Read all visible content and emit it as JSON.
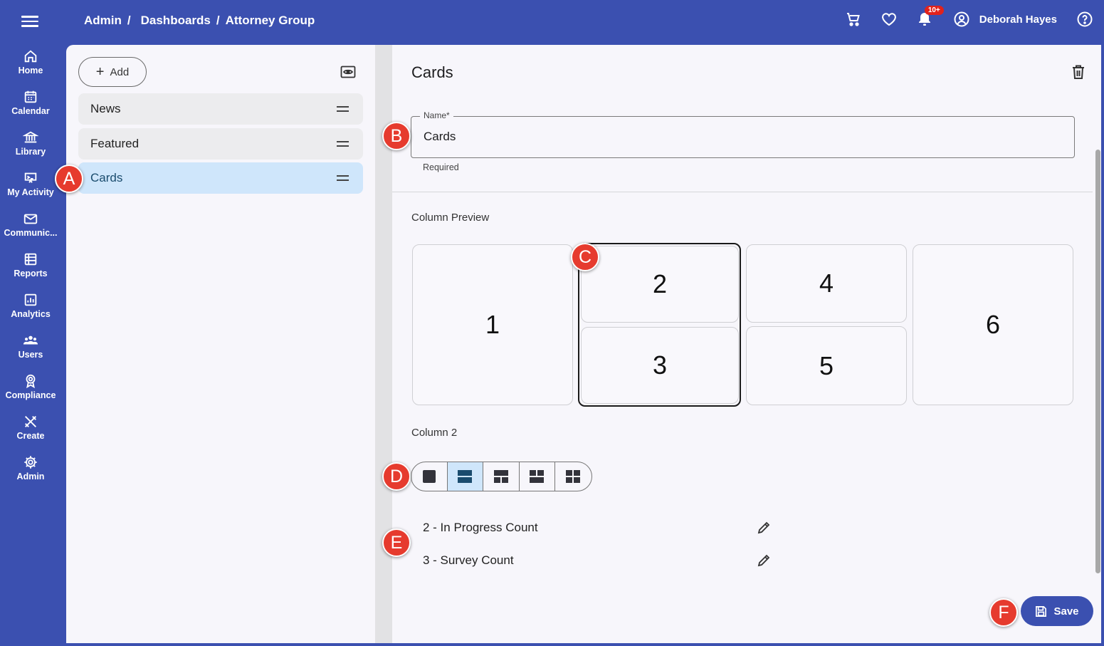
{
  "topbar": {
    "breadcrumb": [
      "Admin",
      "Dashboards",
      "Attorney Group"
    ],
    "separator": "/",
    "notification_count": "10+",
    "user_name": "Deborah Hayes"
  },
  "sidebar": {
    "items": [
      {
        "label": "Home",
        "icon": "home-icon"
      },
      {
        "label": "Calendar",
        "icon": "calendar-icon"
      },
      {
        "label": "Library",
        "icon": "library-icon"
      },
      {
        "label": "My Activity",
        "icon": "activity-icon"
      },
      {
        "label": "Communic...",
        "icon": "mail-icon"
      },
      {
        "label": "Reports",
        "icon": "reports-icon"
      },
      {
        "label": "Analytics",
        "icon": "analytics-icon"
      },
      {
        "label": "Users",
        "icon": "users-icon"
      },
      {
        "label": "Compliance",
        "icon": "compliance-icon"
      },
      {
        "label": "Create",
        "icon": "create-icon"
      },
      {
        "label": "Admin",
        "icon": "admin-gear-icon"
      }
    ]
  },
  "left_panel": {
    "add_label": "Add",
    "items": [
      {
        "label": "News",
        "active": false
      },
      {
        "label": "Featured",
        "active": false
      },
      {
        "label": "Cards",
        "active": true
      }
    ]
  },
  "editor": {
    "title": "Cards",
    "name_label": "Name*",
    "name_value": "Cards",
    "name_helper": "Required",
    "column_preview_label": "Column Preview",
    "preview_cells": [
      "1",
      "2",
      "3",
      "4",
      "5",
      "6"
    ],
    "selected_column_label": "Column 2",
    "layout_options": [
      "single-block",
      "two-rows",
      "one-top-two-bottom",
      "two-by-two-top",
      "four-grid"
    ],
    "selected_layout": 1,
    "cards": [
      {
        "label": "2 - In Progress Count"
      },
      {
        "label": "3 - Survey Count"
      }
    ],
    "save_label": "Save"
  },
  "markers": [
    "A",
    "B",
    "C",
    "D",
    "E",
    "F"
  ],
  "colors": {
    "brand": "#3b50b0",
    "active_bg": "#cfe6fb",
    "marker": "#e63b2e",
    "badge": "#e1221c"
  }
}
